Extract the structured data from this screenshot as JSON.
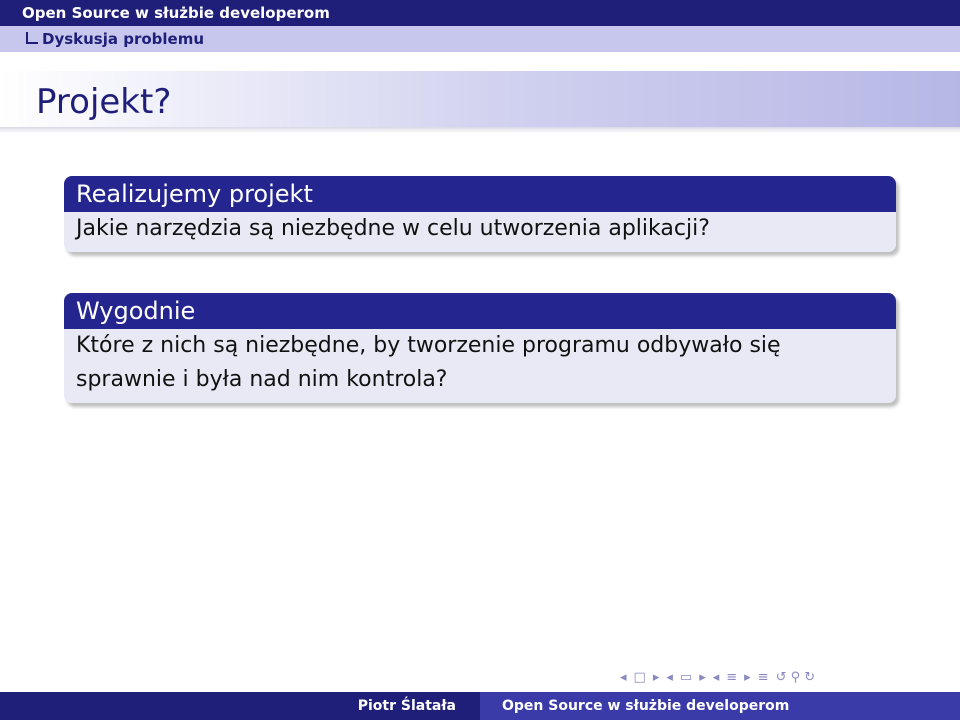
{
  "header": {
    "title": "Open Source w służbie developerom",
    "section": "Dyskusja problemu"
  },
  "frame": {
    "title": "Projekt?"
  },
  "blocks": [
    {
      "title": "Realizujemy projekt",
      "body": "Jakie narzędzia są niezbędne w celu utworzenia aplikacji?"
    },
    {
      "title": "Wygodnie",
      "body": "Które z nich są niezbędne, by tworzenie programu odbywało się sprawnie i była nad nim kontrola?"
    }
  ],
  "navigation": {
    "icons": [
      "nav-frame-left-icon",
      "nav-frame-icon",
      "nav-frame-right-icon",
      "nav-subsection-left-icon",
      "nav-subsection-icon",
      "nav-subsection-right-icon",
      "nav-section-left-icon",
      "nav-section-icon",
      "nav-section-right-icon",
      "nav-document-icon",
      "nav-search-icon"
    ]
  },
  "footer": {
    "author": "Piotr Ślatała",
    "title": "Open Source w służbie developerom"
  },
  "colors": {
    "header": "#1f1f7a",
    "subheader": "#c7c7ee",
    "block_head": "#25258f",
    "block_body": "#e9e9f5",
    "footer_left": "#1f1f7a",
    "footer_right": "#3a3aa8"
  }
}
